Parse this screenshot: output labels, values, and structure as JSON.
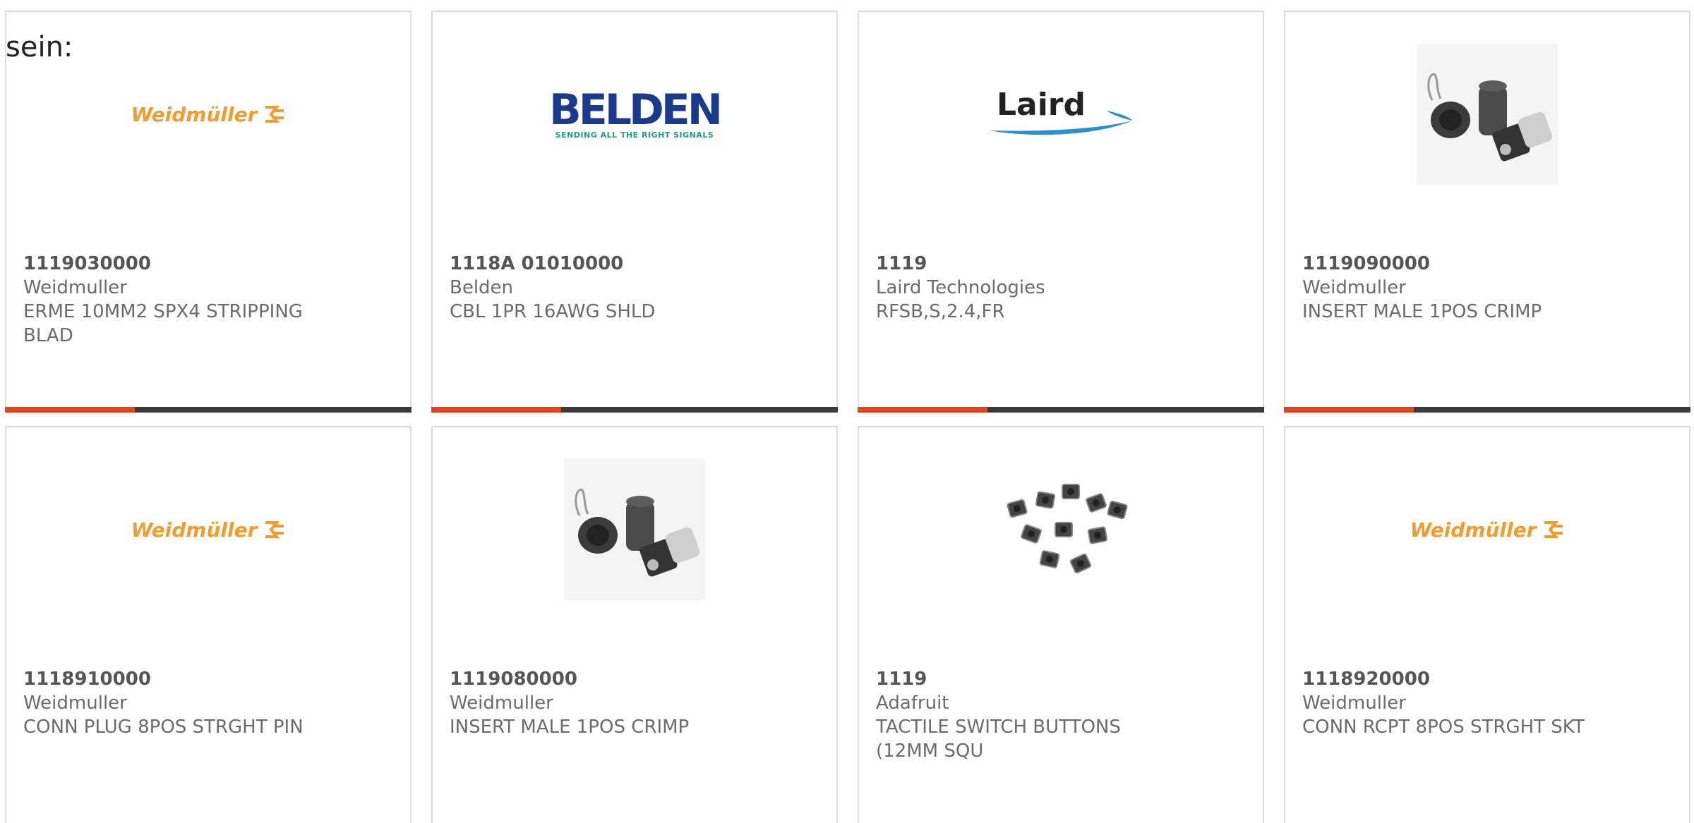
{
  "intro_text": "sein:",
  "products": [
    {
      "part_number": "1119030000",
      "manufacturer": "Weidmuller",
      "description": "ERME 10MM2 SPX4 STRIPPING BLAD",
      "image": "weidmuller-logo",
      "logo_text": "Weidmüller"
    },
    {
      "part_number": "1118A 01010000",
      "manufacturer": "Belden",
      "description": "CBL 1PR 16AWG SHLD",
      "image": "belden-logo",
      "logo_text": "BELDEN",
      "logo_tagline": "SENDING ALL THE RIGHT SIGNALS"
    },
    {
      "part_number": "1119",
      "manufacturer": "Laird Technologies",
      "description": "RFSB,S,2.4,FR",
      "image": "laird-logo",
      "logo_text": "Laird"
    },
    {
      "part_number": "1119090000",
      "manufacturer": "Weidmuller",
      "description": "INSERT MALE 1POS CRIMP",
      "image": "connector-photo"
    },
    {
      "part_number": "1118910000",
      "manufacturer": "Weidmuller",
      "description": "CONN PLUG 8POS STRGHT PIN",
      "image": "weidmuller-logo",
      "logo_text": "Weidmüller"
    },
    {
      "part_number": "1119080000",
      "manufacturer": "Weidmuller",
      "description": "INSERT MALE 1POS CRIMP",
      "image": "connector-photo"
    },
    {
      "part_number": "1119",
      "manufacturer": "Adafruit",
      "description": "TACTILE SWITCH BUTTONS (12MM SQU",
      "image": "tactile-switches-photo"
    },
    {
      "part_number": "1118920000",
      "manufacturer": "Weidmuller",
      "description": "CONN RCPT 8POS STRGHT SKT",
      "image": "weidmuller-logo",
      "logo_text": "Weidmüller"
    }
  ],
  "colors": {
    "accent": "#e8401c",
    "bar": "#3a3a3a",
    "weidmuller_orange": "#f39c2c",
    "belden_blue": "#1a3a8e",
    "laird_blue": "#2a8fd6"
  }
}
